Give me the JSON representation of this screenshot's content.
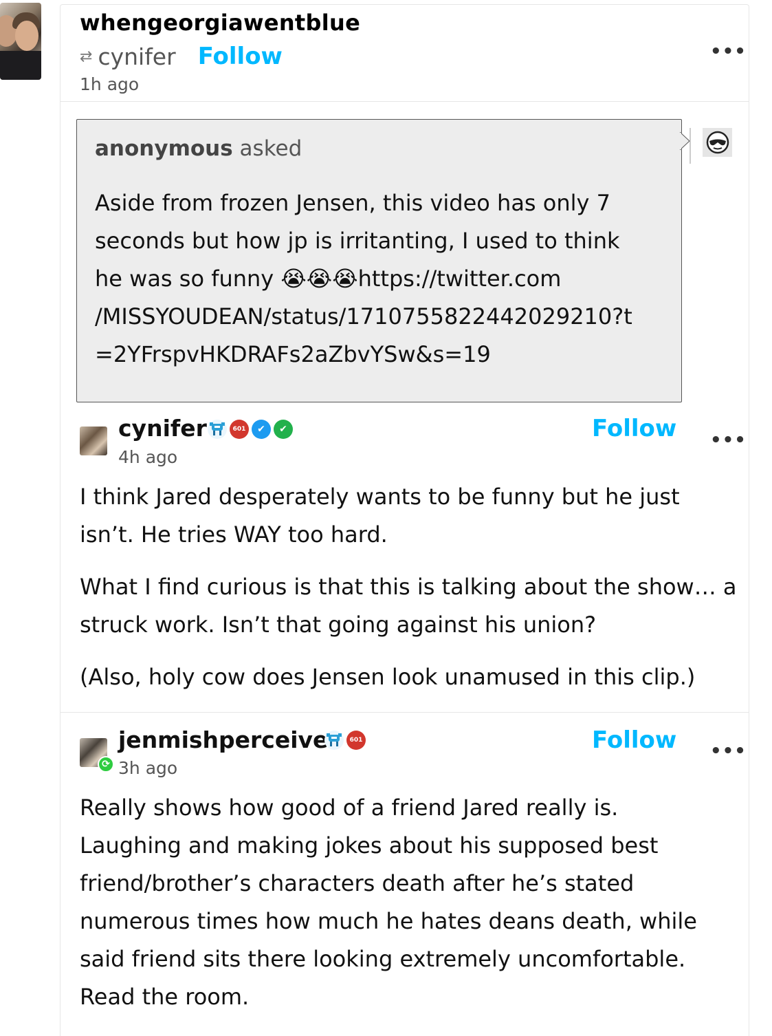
{
  "post": {
    "blog_name": "whengeorgiawentblue",
    "reblog_source": "cynifer",
    "follow_label": "Follow",
    "time": "1h ago",
    "more_label": "•••"
  },
  "ask": {
    "asker": "anonymous",
    "asked_label": "asked",
    "text": "Aside from frozen Jensen, this video has only 7 seconds but how jp is irritanting, I used to think he was so funny 😭😭😭https://twitter.com/MISSYOUDEAN/status/1710755822442029210?t=2YFrspvHKDRAFs2aZbvYSw&s=19",
    "lines": [
      "Aside from frozen Jensen, this video has only 7",
      "seconds but how jp is irritanting, I used to think",
      "he was so funny 😭😭😭https://twitter.com",
      "/MISSYOUDEAN/status/1710755822442029210?t",
      "=2YFrspvHKDRAFs2aZbvYSw&s=19"
    ]
  },
  "reblogs": [
    {
      "username": "cynifer",
      "time": "4h ago",
      "follow_label": "Follow",
      "more_label": "•••",
      "paragraphs": [
        "I think Jared desperately wants to be funny but he just isn’t. He tries WAY too hard.",
        "What I find curious is that this is talking about the show… a struck work. Isn’t that going against his union?",
        "(Also, holy cow does Jensen look unamused in this clip.)"
      ]
    },
    {
      "username": "jenmishperceiver",
      "time": "3h ago",
      "follow_label": "Follow",
      "more_label": "•••",
      "paragraphs": [
        "Really shows how good of a friend Jared really is. Laughing and making jokes about his supposed best friend/brother’s characters death after he’s stated numerous times how much he hates deans death, while said friend sits there looking extremely uncomfortable. Read the room."
      ]
    }
  ],
  "badge_text": "601",
  "colors": {
    "follow": "#00b8ff",
    "ask_bg": "#ededed",
    "badge_red": "#d2372d",
    "badge_blue": "#1d9bf0",
    "badge_green": "#22b14c"
  },
  "icons": [
    "reblog-icon",
    "more-icon",
    "sunglasses-icon",
    "crab-badge-icon",
    "red-hex-badge-icon",
    "verified-blue-icon",
    "verified-green-icon",
    "reblog-green-icon"
  ]
}
